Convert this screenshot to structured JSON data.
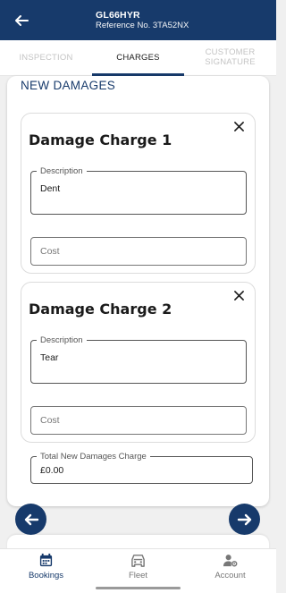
{
  "header": {
    "title": "GL66HYR",
    "subtitle": "Reference No. 3TA52NX"
  },
  "tabs": [
    {
      "label": "INSPECTION",
      "active": false
    },
    {
      "label": "CHARGES",
      "active": true
    },
    {
      "label": "CUSTOMER SIGNATURE",
      "active": false
    }
  ],
  "section_title": "NEW DAMAGES",
  "charges": [
    {
      "title": "Damage Charge 1",
      "description_label": "Description",
      "description_value": "Dent",
      "cost_placeholder": "Cost"
    },
    {
      "title": "Damage Charge 2",
      "description_label": "Description",
      "description_value": "Tear",
      "cost_placeholder": "Cost"
    }
  ],
  "total": {
    "label": "Total New Damages Charge",
    "value": "£0.00"
  },
  "bottom_nav": [
    {
      "label": "Bookings",
      "icon": "calendar-icon",
      "active": true
    },
    {
      "label": "Fleet",
      "icon": "car-icon",
      "active": false
    },
    {
      "label": "Account",
      "icon": "user-settings-icon",
      "active": false
    }
  ],
  "colors": {
    "primary": "#173a6b",
    "inactive_tab": "#c4c4c4",
    "nav_inactive": "#777777"
  }
}
